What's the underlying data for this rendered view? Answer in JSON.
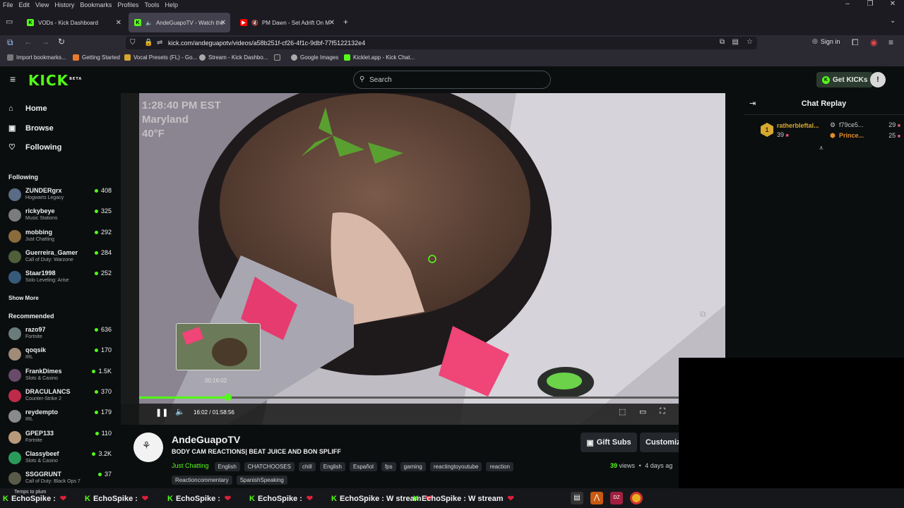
{
  "menubar": {
    "items": [
      "File",
      "Edit",
      "View",
      "History",
      "Bookmarks",
      "Profiles",
      "Tools",
      "Help"
    ]
  },
  "tabs": [
    {
      "title": "VODs - Kick Dashboard",
      "active": false
    },
    {
      "title": "AndeGuapoTV - Watch the",
      "active": true
    },
    {
      "title": "PM Dawn - Set Adrift On M",
      "active": false
    }
  ],
  "address": {
    "url": "kick.com/andeguapotv/videos/a58b251f-cf26-4f1c-9dbf-77f5122132e4"
  },
  "browser_right": {
    "sign_in": "Sign in"
  },
  "bookmarks": [
    "Import bookmarks...",
    "Getting Started",
    "Vocal Presets (FL) - Go...",
    "Stream - Kick Dashbo...",
    "",
    "Google Images",
    "Kicklet.app - Kick Chat..."
  ],
  "header": {
    "logo": "KICK",
    "beta": "BETA",
    "search_placeholder": "Search",
    "get_kicks": "Get KICKs"
  },
  "nav": {
    "home": "Home",
    "browse": "Browse",
    "following": "Following"
  },
  "following": {
    "title": "Following",
    "channels": [
      {
        "name": "ZUNDERgrx",
        "category": "Hogwarts Legacy",
        "viewers": "408",
        "color": "#5a6c86"
      },
      {
        "name": "rickybeye",
        "category": "Music Stations",
        "viewers": "325",
        "color": "#7c7c7c"
      },
      {
        "name": "mobbing",
        "category": "Just Chatting",
        "viewers": "292",
        "color": "#8a6b3c"
      },
      {
        "name": "Guerreira_Gamer",
        "category": "Call of Duty: Warzone",
        "viewers": "284",
        "color": "#4e5f3a"
      },
      {
        "name": "Staar1998",
        "category": "Solo Leveling: Arise",
        "viewers": "252",
        "color": "#385a7a"
      }
    ],
    "show_more": "Show More"
  },
  "recommended": {
    "title": "Recommended",
    "channels": [
      {
        "name": "razo97",
        "category": "Fortnite",
        "viewers": "636",
        "color": "#6b7c7c"
      },
      {
        "name": "qoqsik",
        "category": "IRL",
        "viewers": "170",
        "color": "#a08a78"
      },
      {
        "name": "FrankDimes",
        "category": "Slots & Casino",
        "viewers": "1.5K",
        "color": "#6a4a6a"
      },
      {
        "name": "DRACULANCS",
        "category": "Counter-Strike 2",
        "viewers": "370",
        "color": "#c02a4a"
      },
      {
        "name": "reydempto",
        "category": "IRL",
        "viewers": "179",
        "color": "#8a8a8a"
      },
      {
        "name": "GPEP133",
        "category": "Fortnite",
        "viewers": "110",
        "color": "#b89a7a"
      },
      {
        "name": "Classybeef",
        "category": "Slots & Casino",
        "viewers": "3.2K",
        "color": "#2a9a5a"
      },
      {
        "name": "SSGGRUNT",
        "category": "Call of Duty: Black Ops 7",
        "viewers": "37",
        "color": "#5a5a4a"
      }
    ]
  },
  "video": {
    "overlay_time": "1:28:40 PM EST",
    "overlay_location": "Maryland",
    "overlay_temp": "40°F",
    "preview_time": "00:16:02",
    "current_time": "16:02",
    "separator": "/",
    "duration": "01:58:56",
    "progress": 0.152
  },
  "stream": {
    "channel": "AndeGuapoTV",
    "title": "BODY CAM REACTIONS| BEAT JUICE AND BON SPLIFF",
    "category": "Just Chatting",
    "tags": [
      "English",
      "CHATCHOOSES",
      "chill",
      "English",
      "Español",
      "fps",
      "gaming",
      "reactingtoyoutube",
      "reaction"
    ],
    "tags2": [
      "Reactioncommentary",
      "SpanishSpeaking"
    ],
    "views_count": "39",
    "views_label": "views",
    "ago": "4 days ag",
    "gift_subs": "Gift Subs",
    "customize": "Customiz"
  },
  "chat": {
    "title": "Chat Replay",
    "leader": {
      "rank": "1",
      "name": "ratherbleftal...",
      "count": "39"
    },
    "entries": [
      {
        "name": "f79ce5...",
        "count": "29"
      },
      {
        "name": "Prince...",
        "count": "25"
      }
    ]
  },
  "taskbar": {
    "ticker": [
      "EchoSpike :",
      "EchoSpike :",
      "EchoSpike :",
      "EchoSpike :",
      "EchoSpike : W stream",
      "EchoSpike : W stream"
    ],
    "tray_text": "Temps to plum"
  },
  "colors": {
    "kick_green": "#53fc18",
    "bg": "#0b0e0f",
    "gold": "#d7a830"
  }
}
